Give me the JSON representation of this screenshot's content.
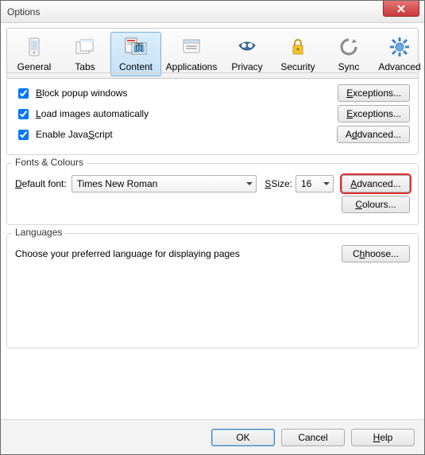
{
  "window": {
    "title": "Options"
  },
  "toolbar": {
    "general": "General",
    "tabs": "Tabs",
    "content": "Content",
    "applications": "Applications",
    "privacy": "Privacy",
    "security": "Security",
    "sync": "Sync",
    "advanced": "Advanced"
  },
  "content": {
    "block_popups": "lock popup windows",
    "load_images": "oad images automatically",
    "enable_js": "cript",
    "enable_js_pre": "Enable Java",
    "exceptions": "xceptions...",
    "advanced": "dvanced..."
  },
  "fonts": {
    "title": "Fonts & Colours",
    "default_font": "efault font:",
    "font_value": "Times New Roman",
    "size": "Size:",
    "size_value": "16",
    "advanced": "dvanced...",
    "colours": "olours..."
  },
  "languages": {
    "title": "Languages",
    "desc": "Choose your preferred language for displaying pages",
    "choose": "hoose..."
  },
  "footer": {
    "ok": "OK",
    "cancel": "Cancel",
    "help": "elp"
  }
}
